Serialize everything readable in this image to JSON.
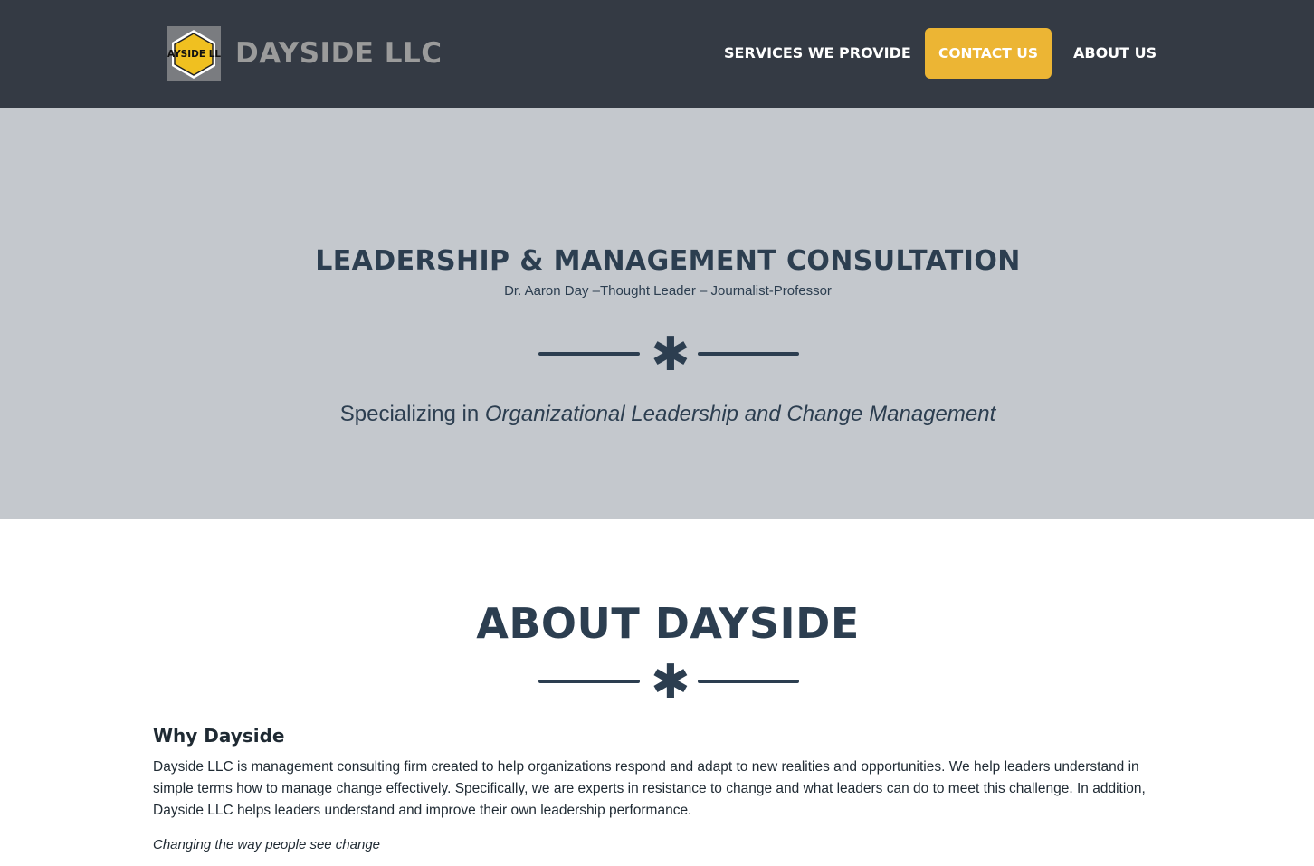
{
  "header": {
    "logo_text": "DAYSIDE LLC",
    "brand": "DAYSIDE LLC",
    "nav": {
      "services": "SERVICES WE PROVIDE",
      "contact": "CONTACT US",
      "about": "ABOUT US"
    }
  },
  "hero": {
    "title": "LEADERSHIP & MANAGEMENT CONSULTATION",
    "subtitle": "Dr. Aaron Day –Thought Leader – Journalist-Professor",
    "tagline_prefix": "Specializing in ",
    "tagline_emphasis": "Organizational Leadership and Change Management"
  },
  "about": {
    "heading": "ABOUT DAYSIDE",
    "why_heading": "Why Dayside",
    "why_body": "Dayside LLC is management consulting firm created to help organizations respond and adapt to new realities and opportunities. We help leaders understand in simple terms how to manage change effectively. Specifically, we are experts in resistance to change and what leaders can do to meet this challenge. In addition, Dayside LLC helps leaders understand and improve their own leadership performance.",
    "motto": "Changing the way people see change"
  },
  "colors": {
    "navbar": "#343a44",
    "accent": "#ecb534",
    "hero_bg": "#c4c8cd",
    "heading": "#2c3e50"
  }
}
